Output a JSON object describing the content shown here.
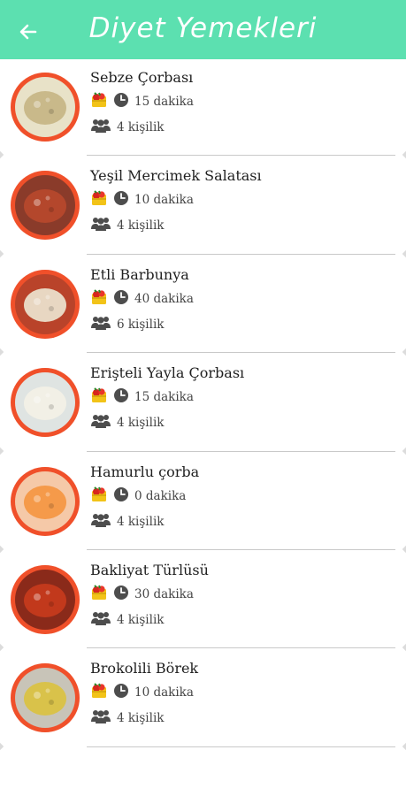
{
  "header": {
    "title": "Diyet Yemekleri",
    "back_icon": "arrow-left-icon",
    "color": "#5ce0b0"
  },
  "recipes": [
    {
      "name": "Sebze Çorbası",
      "time": "15 dakika",
      "servings": "4 kişilik",
      "plate": "#e8e2c8",
      "food": "#c9b98a"
    },
    {
      "name": "Yeşil Mercimek Salatası",
      "time": "10 dakika",
      "servings": "4 kişilik",
      "plate": "#8a3b2a",
      "food": "#b4472c"
    },
    {
      "name": "Etli Barbunya",
      "time": "40 dakika",
      "servings": "6 kişilik",
      "plate": "#b9432a",
      "food": "#e8d7c2"
    },
    {
      "name": "Erişteli Yayla Çorbası",
      "time": "15 dakika",
      "servings": "4 kişilik",
      "plate": "#dfe4e2",
      "food": "#f2f0e6"
    },
    {
      "name": "Hamurlu çorba",
      "time": "0 dakika",
      "servings": "4 kişilik",
      "plate": "#f5c9a8",
      "food": "#f59a4a"
    },
    {
      "name": "Bakliyat Türlüsü",
      "time": "30 dakika",
      "servings": "4 kişilik",
      "plate": "#8a2a1a",
      "food": "#c2391c"
    },
    {
      "name": "Brokolili Börek",
      "time": "10 dakika",
      "servings": "4 kişilik",
      "plate": "#c8c4b8",
      "food": "#d9c24a"
    }
  ],
  "icons": {
    "category": "vegetable-basket-icon",
    "time": "clock-icon",
    "servings": "people-icon"
  },
  "colors": {
    "thumb_ring": "#f0502a",
    "divider": "#c9c9c9"
  }
}
